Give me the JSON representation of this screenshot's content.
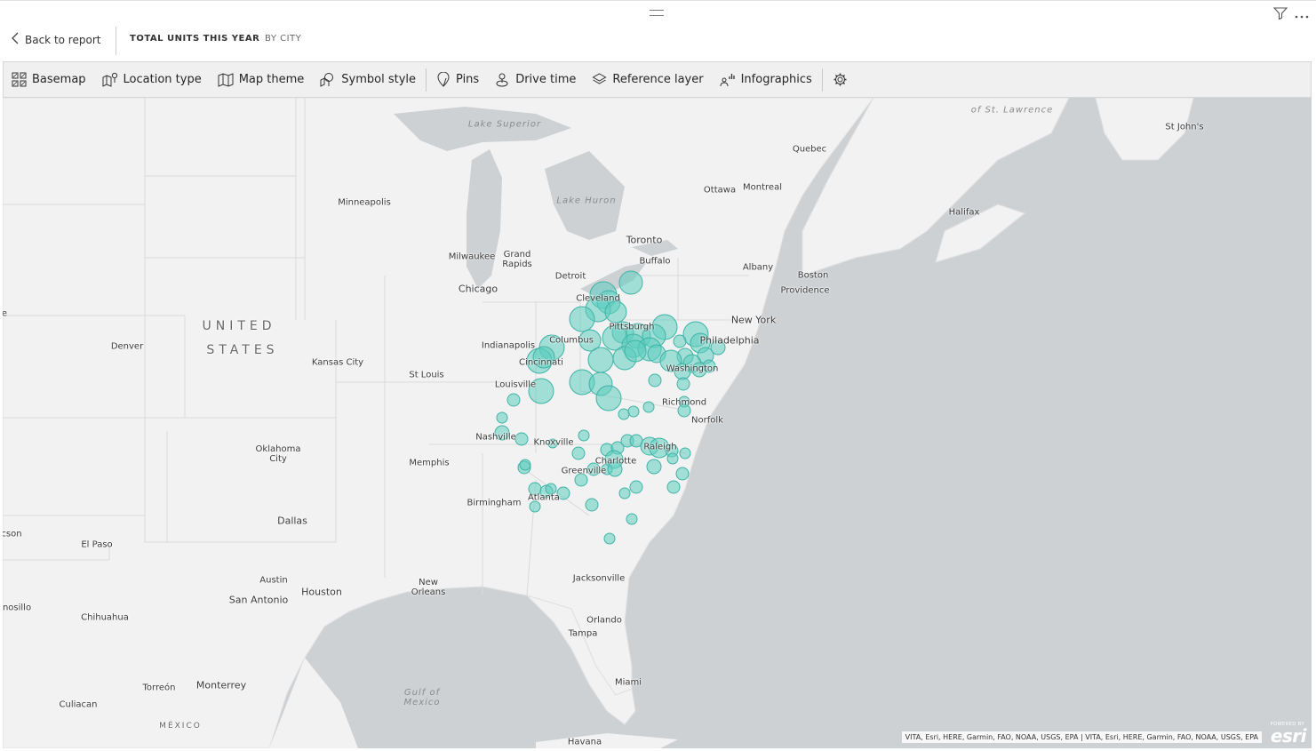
{
  "header": {
    "back_label": "Back to report",
    "title": "TOTAL UNITS THIS YEAR",
    "subtitle": "BY CITY"
  },
  "top_icons": [
    "filter-icon",
    "more-options-icon"
  ],
  "toolbar": {
    "items": [
      {
        "label": "Basemap",
        "icon": "basemap-icon"
      },
      {
        "label": "Location type",
        "icon": "location-type-icon"
      },
      {
        "label": "Map theme",
        "icon": "map-theme-icon"
      },
      {
        "label": "Symbol style",
        "icon": "symbol-style-icon"
      },
      {
        "label": "Pins",
        "icon": "pin-icon"
      },
      {
        "label": "Drive time",
        "icon": "drive-time-icon"
      },
      {
        "label": "Reference layer",
        "icon": "reference-layer-icon"
      },
      {
        "label": "Infographics",
        "icon": "infographics-icon"
      }
    ],
    "settings_icon": "gear-icon"
  },
  "map": {
    "labels": {
      "lake_superior": "Lake Superior",
      "lake_huron": "Lake Huron",
      "gulf_st_lawrence": "of St. Lawrence",
      "gulf_mexico": "Gulf of Mexico",
      "united": "UNITED",
      "states": "STATES",
      "mexico": "MÉXICO",
      "st_johns": "St John's",
      "quebec": "Quebec",
      "ottawa": "Ottawa",
      "montreal": "Montreal",
      "halifax": "Halifax",
      "minneapolis": "Minneapolis",
      "toronto": "Toronto",
      "milwaukee": "Milwaukee",
      "grand_rapids": "Grand Rapids",
      "buffalo": "Buffalo",
      "detroit": "Detroit",
      "albany": "Albany",
      "boston": "Boston",
      "providence": "Providence",
      "chicago": "Chicago",
      "cleveland": "Cleveland",
      "new_york": "New York",
      "pittsburgh": "Pittsburgh",
      "philadelphia": "Philadelphia",
      "columbus": "Columbus",
      "indianapolis": "Indianapolis",
      "denver": "Denver",
      "cincinnati": "Cincinnati",
      "kansas_city": "Kansas City",
      "washington": "Washington",
      "st_louis": "St Louis",
      "louisville": "Louisville",
      "richmond": "Richmond",
      "norfolk": "Norfolk",
      "nashville": "Nashville",
      "knoxville": "Knoxville",
      "raleigh": "Raleigh",
      "oklahoma_city": "Oklahoma City",
      "charlotte": "Charlotte",
      "memphis": "Memphis",
      "greenville": "Greenville",
      "atlanta": "Atlanta",
      "birmingham": "Birmingham",
      "dallas": "Dallas",
      "tucson": "cson",
      "el_paso": "El Paso",
      "austin": "Austin",
      "new_orleans": "New Orleans",
      "jacksonville": "Jacksonville",
      "houston": "Houston",
      "san_antonio": "San Antonio",
      "hermosillo": "nosillo",
      "chihuahua": "Chihuahua",
      "orlando": "Orlando",
      "tampa": "Tampa",
      "miami": "Miami",
      "torreon": "Torreón",
      "monterrey": "Monterrey",
      "culiacan": "Culiacan",
      "havana": "Havana",
      "edge_e": "e"
    },
    "bubble_color": "#5ccdc0",
    "bubble_stroke": "#3fb3a6",
    "attribution": "VITA, Esri, HERE, Garmin, FAO, NOAA, USGS, EPA | VITA, Esri, HERE, Garmin, FAO, NOAA, USGS, EPA",
    "esri_powered": "POWERED BY",
    "esri_logo": "esri"
  }
}
